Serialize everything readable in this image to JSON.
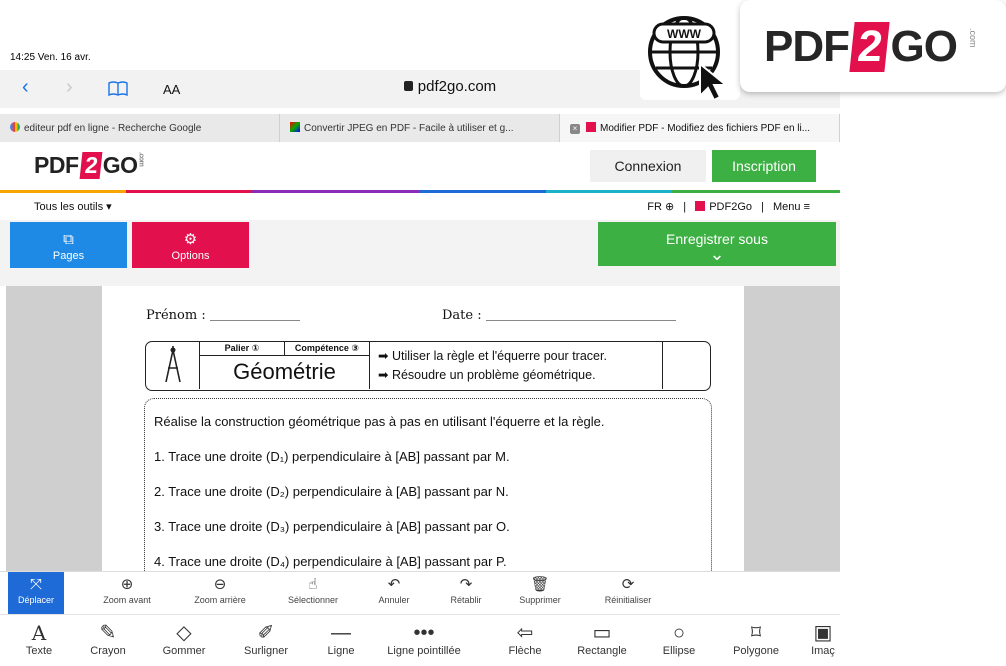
{
  "status_bar": {
    "time_date": "14:25  Ven. 16 avr."
  },
  "safari": {
    "aa": "AA",
    "url": "pdf2go.com"
  },
  "tabs": [
    {
      "label": "editeur pdf en ligne - Recherche Google"
    },
    {
      "label": "Convertir JPEG en PDF - Facile à utiliser et g..."
    },
    {
      "label": "Modifier PDF - Modifiez des fichiers PDF en li..."
    }
  ],
  "site": {
    "logo_left": "PDF",
    "logo_num": "2",
    "logo_right": "GO",
    "logo_dotcom": ".com",
    "connexion": "Connexion",
    "inscription": "Inscription",
    "all_tools": "Tous les outils ▾",
    "lang": "FR ⊕",
    "pdf2go_link": "PDF2Go",
    "menu": "Menu ≡",
    "sep": "|"
  },
  "actions": {
    "pages": "Pages",
    "options": "Options",
    "save": "Enregistrer sous",
    "save_chev": "⌄"
  },
  "document": {
    "prenom": "Prénom :",
    "date": "Date :",
    "palier": "Palier ①",
    "competence": "Compétence ③",
    "title": "Géométrie",
    "objective1": "➡ Utiliser la règle et l'équerre pour tracer.",
    "objective2": "➡ Résoudre un problème géométrique.",
    "intro": "Réalise la construction géométrique pas à pas en utilisant l'équerre et la règle.",
    "steps": [
      "1. Trace une droite (D₁) perpendiculaire à [AB] passant par M.",
      "2. Trace une droite (D₂) perpendiculaire à [AB] passant par N.",
      "3. Trace une droite (D₃) perpendiculaire à [AB] passant par O.",
      "4. Trace une droite (D₄) perpendiculaire à [AB] passant par P."
    ]
  },
  "toolbar_top": [
    {
      "label": "Déplacer",
      "icon": "⤧",
      "name": "move-icon"
    },
    {
      "label": "Zoom avant",
      "icon": "⊕",
      "name": "zoom-in-icon"
    },
    {
      "label": "Zoom arrière",
      "icon": "⊖",
      "name": "zoom-out-icon"
    },
    {
      "label": "Sélectionner",
      "icon": "☝",
      "name": "select-icon"
    },
    {
      "label": "Annuler",
      "icon": "↶",
      "name": "undo-icon"
    },
    {
      "label": "Rétablir",
      "icon": "↷",
      "name": "redo-icon"
    },
    {
      "label": "Supprimer",
      "icon": "🗑",
      "name": "trash-icon"
    },
    {
      "label": "Réinitialiser",
      "icon": "⟳",
      "name": "reset-icon"
    }
  ],
  "toolbar_bottom": [
    {
      "label": "Texte",
      "icon": "A",
      "name": "text-icon"
    },
    {
      "label": "Crayon",
      "icon": "✎",
      "name": "pencil-icon"
    },
    {
      "label": "Gommer",
      "icon": "◇",
      "name": "eraser-icon"
    },
    {
      "label": "Surligner",
      "icon": "✐",
      "name": "highlighter-icon"
    },
    {
      "label": "Ligne",
      "icon": "—",
      "name": "line-icon"
    },
    {
      "label": "Ligne pointillée",
      "icon": "•••",
      "name": "dotted-line-icon"
    },
    {
      "label": "Flèche",
      "icon": "⇦",
      "name": "arrow-icon"
    },
    {
      "label": "Rectangle",
      "icon": "▭",
      "name": "rectangle-icon"
    },
    {
      "label": "Ellipse",
      "icon": "○",
      "name": "ellipse-icon"
    },
    {
      "label": "Polygone",
      "icon": "⌑",
      "name": "polygon-icon"
    },
    {
      "label": "Imaç",
      "icon": "▣",
      "name": "image-icon"
    }
  ],
  "overlay": {
    "logo_left": "PDF",
    "logo_num": "2",
    "logo_right": "GO",
    "dotcom": ".com",
    "www": "WWW"
  },
  "colors": {
    "accent_green": "#3cb043",
    "accent_blue": "#1e8ae6",
    "accent_red": "#e2114e",
    "safari_blue": "#1a73e8"
  }
}
